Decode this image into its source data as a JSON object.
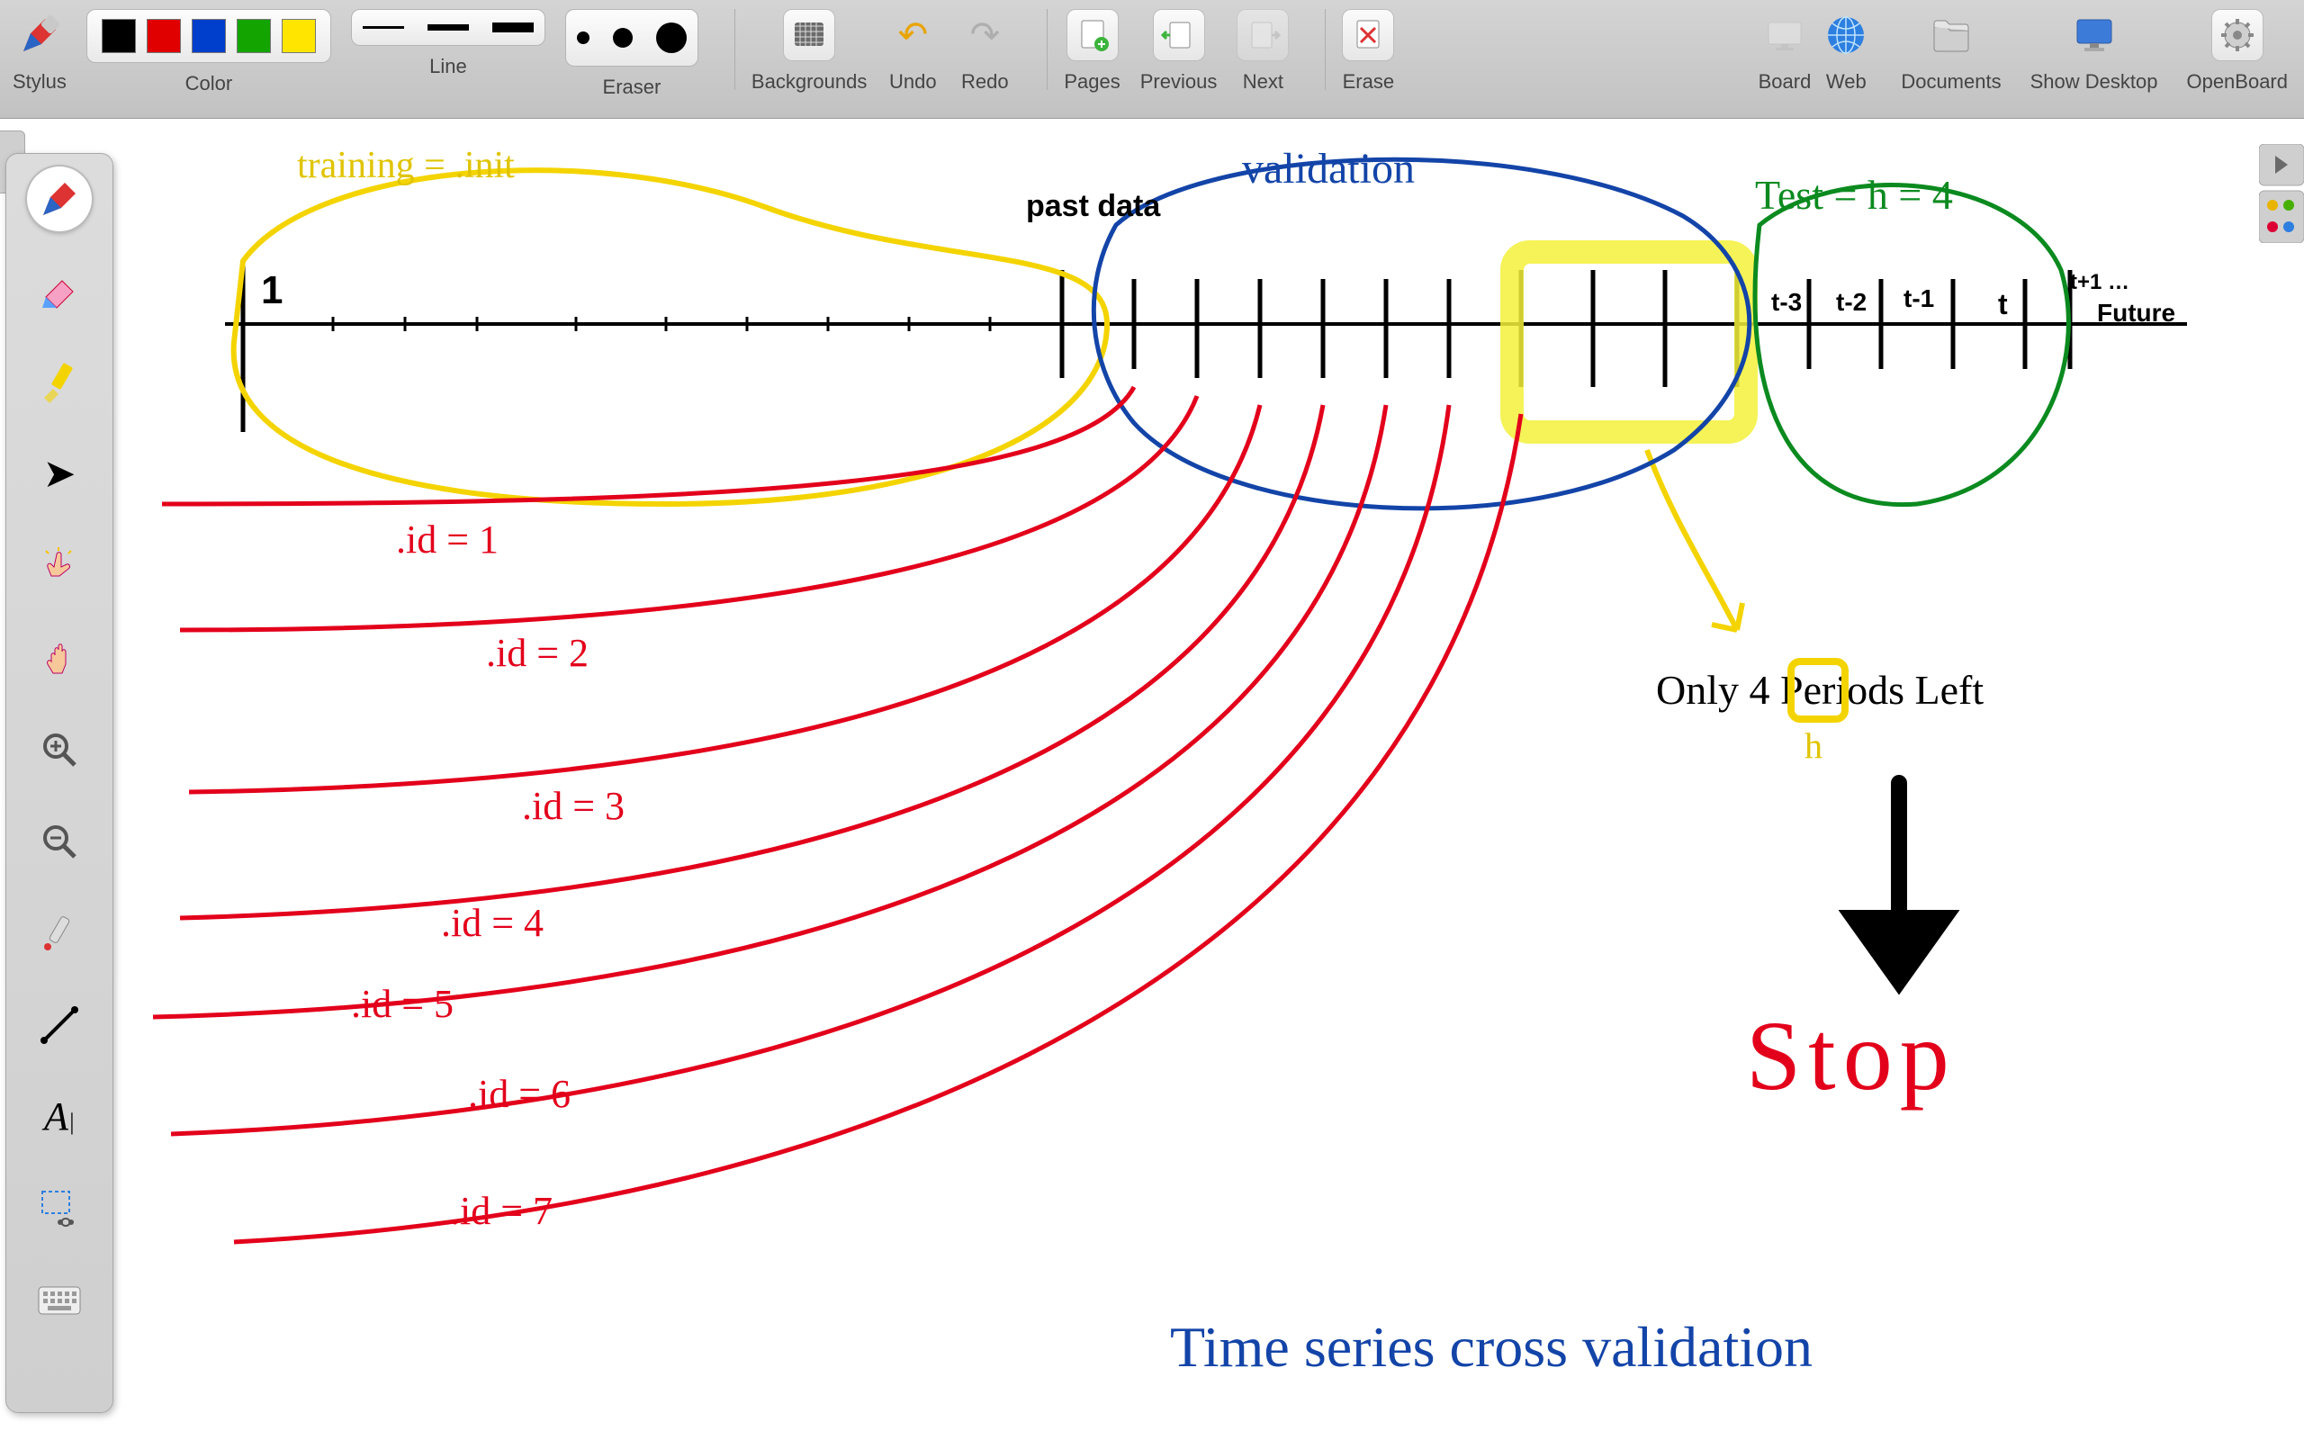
{
  "app": {
    "name": "OpenBoard"
  },
  "toolbar": {
    "stylus": "Stylus",
    "color": "Color",
    "line": "Line",
    "eraser": "Eraser",
    "backgrounds": "Backgrounds",
    "undo": "Undo",
    "redo": "Redo",
    "pages": "Pages",
    "previous": "Previous",
    "next": "Next",
    "erase": "Erase",
    "board": "Board",
    "web": "Web",
    "documents": "Documents",
    "show_desktop": "Show Desktop",
    "openboard": "OpenBoard"
  },
  "colors": [
    "#000000",
    "#e00000",
    "#003ecc",
    "#14a400",
    "#ffe500"
  ],
  "side_tools": [
    "pen-tool",
    "eraser-tool",
    "highlighter-tool",
    "pointer-tool",
    "interact-tool",
    "hand-scroll-tool",
    "zoom-in-tool",
    "zoom-out-tool",
    "laser-tool",
    "line-tool",
    "text-tool",
    "capture-tool",
    "keyboard-tool"
  ],
  "canvas_text": {
    "training_label": "training = .init",
    "past_data": "past data",
    "validation": "validation",
    "test_label": "Test = h = 4",
    "tick_1": "1",
    "tick_tm3": "t-3",
    "tick_tm2": "t-2",
    "tick_tm1": "t-1",
    "tick_t": "t",
    "tick_tp1": "t+1 …",
    "future": "Future",
    "only_4_periods": "Only 4 Periods Left",
    "h_under_4": "h",
    "stop": "Stop",
    "title": "Time series cross validation",
    "ids": [
      ".id = 1",
      ".id = 2",
      ".id = 3",
      ".id = 4",
      ".id = 5",
      ".id = 6",
      ".id = 7"
    ]
  }
}
